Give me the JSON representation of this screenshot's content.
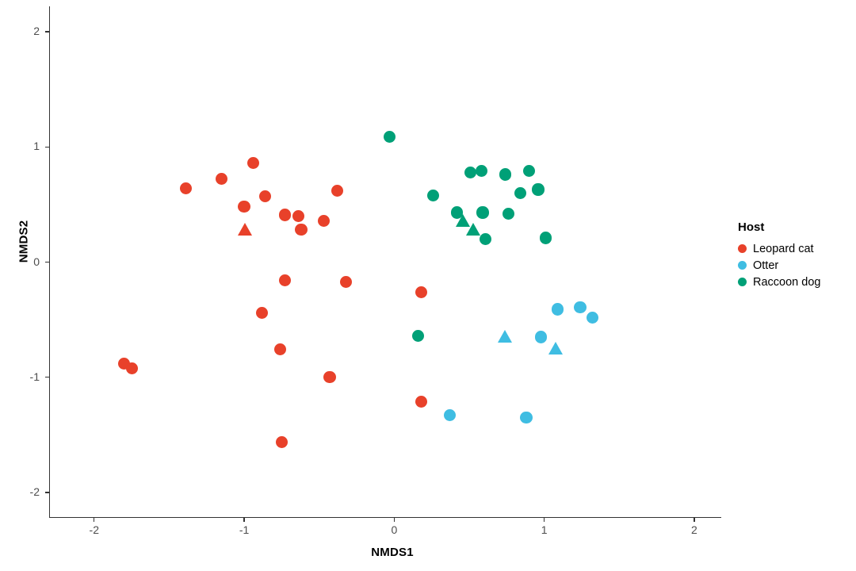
{
  "chart_data": {
    "type": "scatter",
    "title": "",
    "xlabel": "NMDS1",
    "ylabel": "NMDS2",
    "xlim": [
      -2.3,
      2.18
    ],
    "ylim": [
      -2.22,
      2.22
    ],
    "xticks": [
      -2,
      -1,
      0,
      1,
      2
    ],
    "xticklabels": [
      "-2",
      "-1",
      "0",
      "1",
      "2"
    ],
    "yticks": [
      -2,
      -1,
      0,
      1,
      2
    ],
    "yticklabels": [
      "-2",
      "-1",
      "0",
      "1",
      "2"
    ],
    "grid": false,
    "legend_position": "right",
    "legend_title": "Host",
    "colors": {
      "Leopard cat": "#E8412A",
      "Otter": "#3FBDE2",
      "Raccoon dog": "#00A077"
    },
    "series": [
      {
        "name": "Leopard cat",
        "color": "#E8412A",
        "points": [
          {
            "x": -1.39,
            "y": 0.64,
            "shape": "circle"
          },
          {
            "x": -1.15,
            "y": 0.72,
            "shape": "circle"
          },
          {
            "x": -0.94,
            "y": 0.86,
            "shape": "circle"
          },
          {
            "x": -0.86,
            "y": 0.57,
            "shape": "circle"
          },
          {
            "x": -1.0,
            "y": 0.48,
            "shape": "circle"
          },
          {
            "x": -0.99,
            "y": 0.27,
            "shape": "triangle"
          },
          {
            "x": -0.73,
            "y": 0.41,
            "shape": "circle"
          },
          {
            "x": -0.64,
            "y": 0.4,
            "shape": "circle"
          },
          {
            "x": -0.62,
            "y": 0.28,
            "shape": "circle"
          },
          {
            "x": -0.47,
            "y": 0.36,
            "shape": "circle"
          },
          {
            "x": -0.38,
            "y": 0.62,
            "shape": "circle"
          },
          {
            "x": -0.73,
            "y": -0.16,
            "shape": "circle"
          },
          {
            "x": -0.32,
            "y": -0.17,
            "shape": "circle"
          },
          {
            "x": -0.88,
            "y": -0.44,
            "shape": "circle"
          },
          {
            "x": -0.76,
            "y": -0.76,
            "shape": "circle"
          },
          {
            "x": -0.43,
            "y": -1.0,
            "shape": "circle"
          },
          {
            "x": -0.75,
            "y": -1.56,
            "shape": "circle"
          },
          {
            "x": -1.8,
            "y": -0.88,
            "shape": "circle"
          },
          {
            "x": -1.75,
            "y": -0.92,
            "shape": "circle"
          },
          {
            "x": 0.18,
            "y": -0.26,
            "shape": "circle"
          },
          {
            "x": 0.18,
            "y": -1.21,
            "shape": "circle"
          }
        ]
      },
      {
        "name": "Otter",
        "color": "#3FBDE2",
        "points": [
          {
            "x": 1.09,
            "y": -0.41,
            "shape": "circle"
          },
          {
            "x": 1.24,
            "y": -0.39,
            "shape": "circle"
          },
          {
            "x": 1.32,
            "y": -0.48,
            "shape": "circle"
          },
          {
            "x": 0.98,
            "y": -0.65,
            "shape": "circle"
          },
          {
            "x": 0.74,
            "y": -0.66,
            "shape": "triangle"
          },
          {
            "x": 1.08,
            "y": -0.76,
            "shape": "triangle"
          },
          {
            "x": 0.37,
            "y": -1.33,
            "shape": "circle"
          },
          {
            "x": 0.88,
            "y": -1.35,
            "shape": "circle"
          }
        ]
      },
      {
        "name": "Raccoon dog",
        "color": "#00A077",
        "points": [
          {
            "x": -0.03,
            "y": 1.09,
            "shape": "circle"
          },
          {
            "x": 0.51,
            "y": 0.78,
            "shape": "circle"
          },
          {
            "x": 0.58,
            "y": 0.79,
            "shape": "circle"
          },
          {
            "x": 0.74,
            "y": 0.76,
            "shape": "circle"
          },
          {
            "x": 0.9,
            "y": 0.79,
            "shape": "circle"
          },
          {
            "x": 0.84,
            "y": 0.6,
            "shape": "circle"
          },
          {
            "x": 0.96,
            "y": 0.63,
            "shape": "circle"
          },
          {
            "x": 0.26,
            "y": 0.58,
            "shape": "circle"
          },
          {
            "x": 0.42,
            "y": 0.43,
            "shape": "circle"
          },
          {
            "x": 0.59,
            "y": 0.43,
            "shape": "circle"
          },
          {
            "x": 0.76,
            "y": 0.42,
            "shape": "circle"
          },
          {
            "x": 0.46,
            "y": 0.35,
            "shape": "triangle"
          },
          {
            "x": 0.53,
            "y": 0.27,
            "shape": "triangle"
          },
          {
            "x": 0.61,
            "y": 0.2,
            "shape": "circle"
          },
          {
            "x": 1.01,
            "y": 0.21,
            "shape": "circle"
          },
          {
            "x": 0.16,
            "y": -0.64,
            "shape": "circle"
          }
        ]
      }
    ]
  },
  "legend": {
    "title": "Host",
    "entries": [
      {
        "label": "Leopard cat",
        "color": "#E8412A",
        "key": "legend-swatch-leopard-cat"
      },
      {
        "label": "Otter",
        "color": "#3FBDE2",
        "key": "legend-swatch-otter"
      },
      {
        "label": "Raccoon dog",
        "color": "#00A077",
        "key": "legend-swatch-raccoon-dog"
      }
    ]
  },
  "axes": {
    "x_title": "NMDS1",
    "y_title": "NMDS2"
  }
}
